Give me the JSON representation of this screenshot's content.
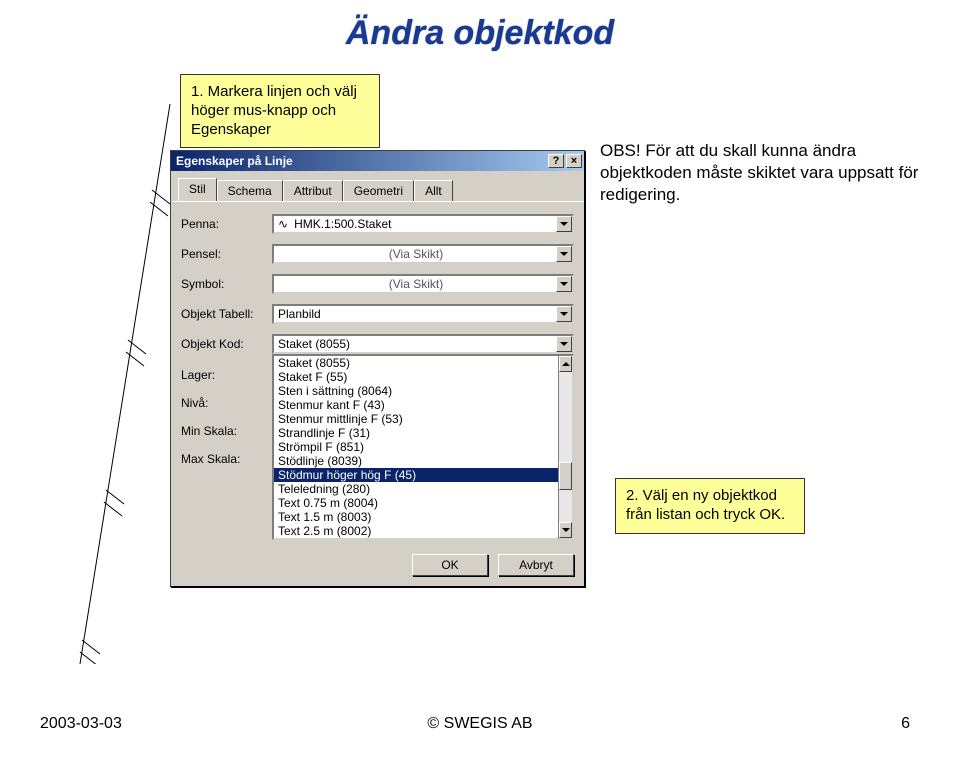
{
  "page": {
    "title": "Ändra objektkod"
  },
  "callout1": {
    "text": "1. Markera linjen och välj höger mus-knapp och Egenskaper"
  },
  "callout2": {
    "text": "2. Välj en ny objektkod från listan och tryck OK."
  },
  "note": {
    "text": "OBS! För att du skall kunna ändra objektkoden måste skiktet vara uppsatt för redigering."
  },
  "dialog": {
    "title": "Egenskaper på Linje",
    "help_btn": "?",
    "close_btn": "×",
    "tabs": [
      "Stil",
      "Schema",
      "Attribut",
      "Geometri",
      "Allt"
    ],
    "active_tab": "Stil",
    "fields": {
      "penna": {
        "label": "Penna:",
        "value": "HMK.1:500.Staket",
        "prefix": "∿"
      },
      "pensel": {
        "label": "Pensel:",
        "value": "(Via Skikt)"
      },
      "symbol": {
        "label": "Symbol:",
        "value": "(Via Skikt)"
      },
      "tabell": {
        "label": "Objekt Tabell:",
        "value": "Planbild"
      },
      "kod": {
        "label": "Objekt Kod:",
        "value": "Staket (8055)"
      },
      "lager": {
        "label": "Lager:"
      },
      "niva": {
        "label": "Nivå:"
      },
      "minskala": {
        "label": "Min Skala:"
      },
      "maxskala": {
        "label": "Max Skala:"
      }
    },
    "list_items": [
      "Staket (8055)",
      "Staket F (55)",
      "Sten i sättning (8064)",
      "Stenmur kant F (43)",
      "Stenmur mittlinje F (53)",
      "Strandlinje F (31)",
      "Strömpil F (851)",
      "Stödlinje (8039)",
      "Stödmur höger hög F (45)",
      "Teleledning (280)",
      "Text 0.75 m (8004)",
      "Text 1.5 m (8003)",
      "Text 2.5 m (8002)"
    ],
    "selected_index": 8,
    "ok_label": "OK",
    "cancel_label": "Avbryt"
  },
  "footer": {
    "date": "2003-03-03",
    "copy": "© SWEGIS AB",
    "page": "6"
  }
}
